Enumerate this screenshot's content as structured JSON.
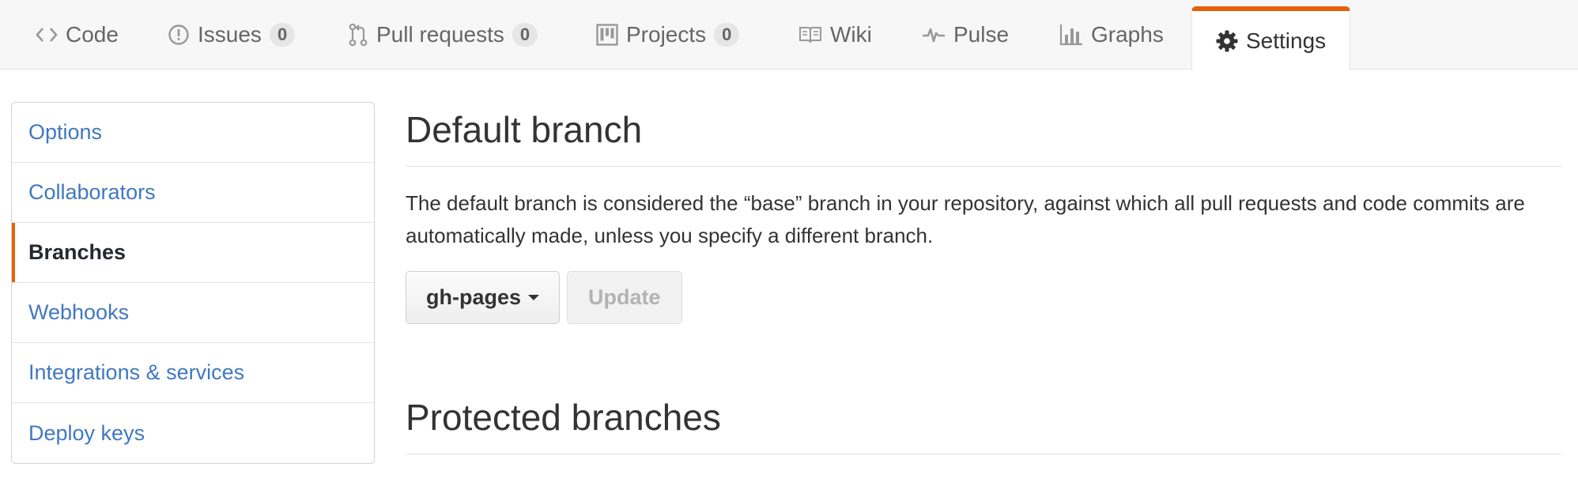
{
  "tabs": [
    {
      "label": "Code",
      "icon": "code-icon"
    },
    {
      "label": "Issues",
      "icon": "issue-opened-icon",
      "count": "0"
    },
    {
      "label": "Pull requests",
      "icon": "git-pull-request-icon",
      "count": "0"
    },
    {
      "label": "Projects",
      "icon": "project-icon",
      "count": "0"
    },
    {
      "label": "Wiki",
      "icon": "book-icon"
    },
    {
      "label": "Pulse",
      "icon": "pulse-icon"
    },
    {
      "label": "Graphs",
      "icon": "graph-icon"
    },
    {
      "label": "Settings",
      "icon": "gear-icon",
      "selected": true
    }
  ],
  "sidebar": {
    "items": [
      {
        "label": "Options"
      },
      {
        "label": "Collaborators"
      },
      {
        "label": "Branches",
        "selected": true
      },
      {
        "label": "Webhooks"
      },
      {
        "label": "Integrations & services"
      },
      {
        "label": "Deploy keys"
      }
    ]
  },
  "default_branch": {
    "title": "Default branch",
    "description": "The default branch is considered the “base” branch in your repository, against which all pull requests and code commits are automatically made, unless you specify a different branch.",
    "branch_button": "gh-pages",
    "update_button": "Update"
  },
  "protected_branches": {
    "title": "Protected branches"
  },
  "colors": {
    "accent": "#e36209",
    "link": "#4078c0",
    "text": "#333333",
    "muted": "#666666"
  }
}
